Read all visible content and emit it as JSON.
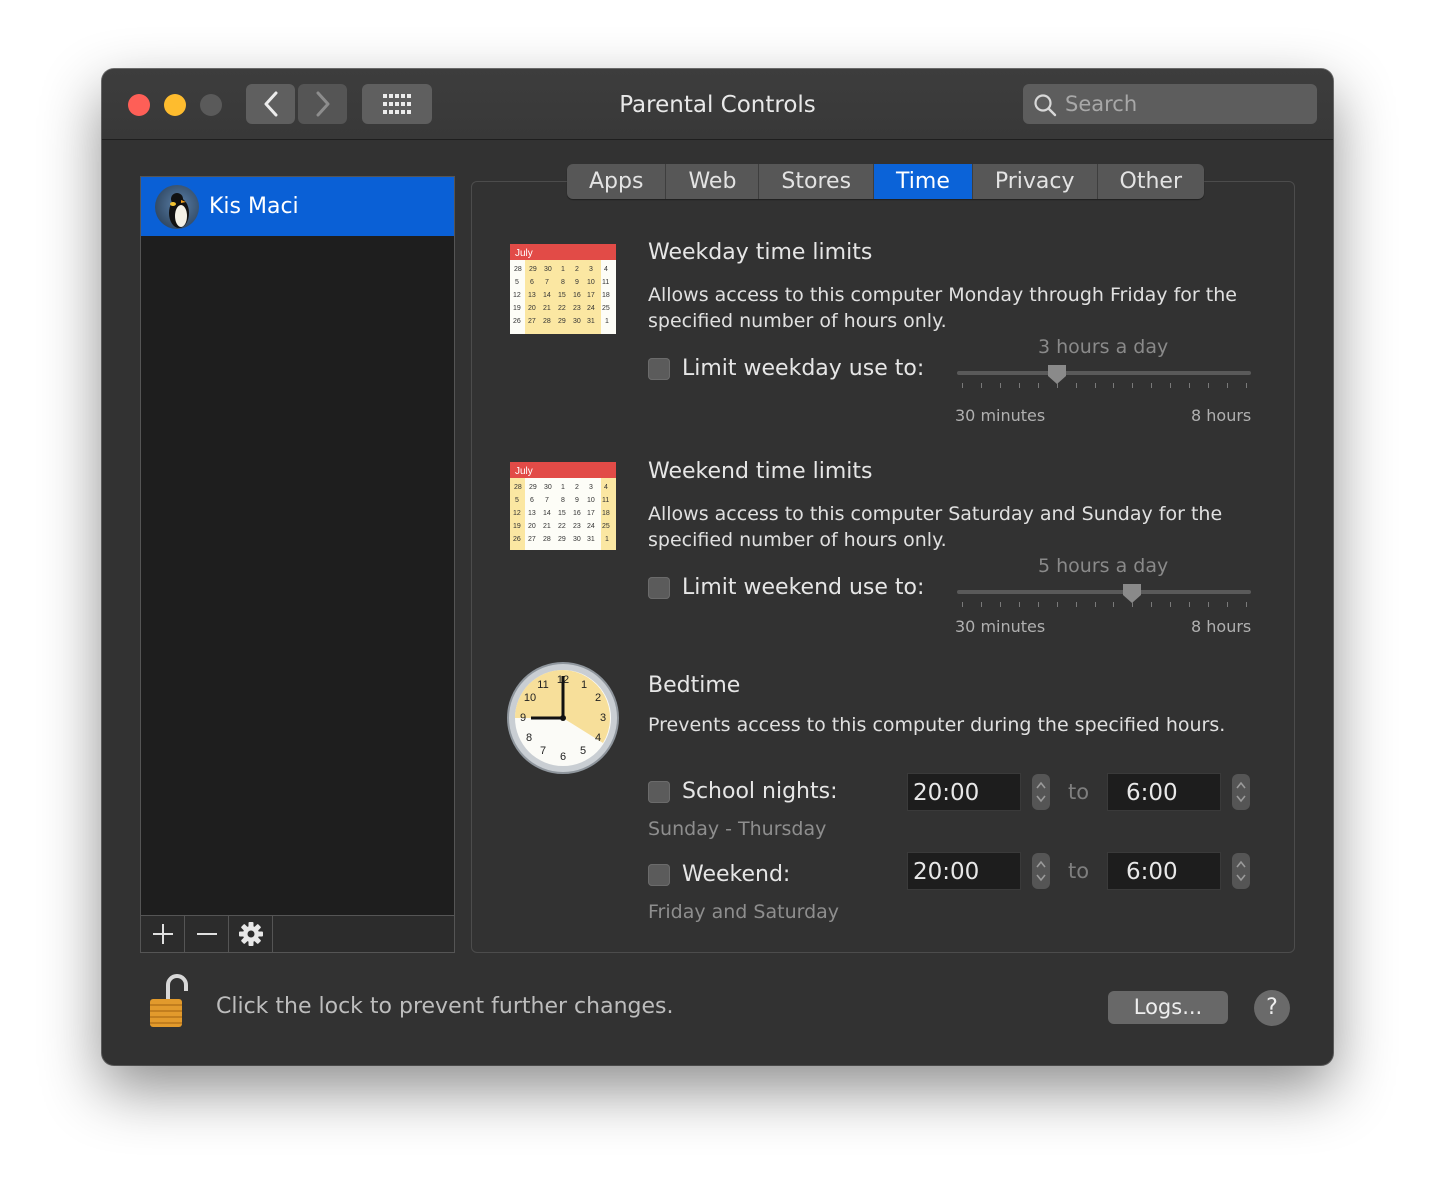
{
  "window": {
    "title": "Parental Controls",
    "search_placeholder": "Search"
  },
  "sidebar": {
    "users": [
      {
        "name": "Kis Maci",
        "selected": true
      }
    ],
    "toolbar": {
      "add": "+",
      "remove": "—"
    }
  },
  "tabs": [
    {
      "label": "Apps",
      "active": false
    },
    {
      "label": "Web",
      "active": false
    },
    {
      "label": "Stores",
      "active": false
    },
    {
      "label": "Time",
      "active": true
    },
    {
      "label": "Privacy",
      "active": false
    },
    {
      "label": "Other",
      "active": false
    }
  ],
  "weekday": {
    "title": "Weekday time limits",
    "description": "Allows access to this computer Monday through Friday for the specified number of hours only.",
    "checkbox_label": "Limit weekday use to:",
    "checked": false,
    "slider_value_label": "3 hours a day",
    "slider_min_label": "30 minutes",
    "slider_max_label": "8 hours",
    "slider_hours": 3,
    "calendar_month": "July"
  },
  "weekend": {
    "title": "Weekend time limits",
    "description": "Allows access to this computer Saturday and Sunday for the specified number of hours only.",
    "checkbox_label": "Limit weekend use to:",
    "checked": false,
    "slider_value_label": "5 hours a day",
    "slider_min_label": "30 minutes",
    "slider_max_label": "8 hours",
    "slider_hours": 5,
    "calendar_month": "July"
  },
  "bedtime": {
    "title": "Bedtime",
    "description": "Prevents access to this computer during the specified hours.",
    "to_label": "to",
    "school": {
      "label": "School nights:",
      "days": "Sunday - Thursday",
      "from": "20:00",
      "to": "6:00",
      "checked": false
    },
    "weekend": {
      "label": "Weekend:",
      "days": "Friday and Saturday",
      "from": "20:00",
      "to": "6:00",
      "checked": false
    }
  },
  "footer": {
    "lock_text": "Click the lock to prevent further changes.",
    "logs_button": "Logs...",
    "help_button": "?"
  },
  "colors": {
    "accent": "#0b63d8",
    "close": "#fe5f57",
    "minimize": "#febc2e"
  }
}
